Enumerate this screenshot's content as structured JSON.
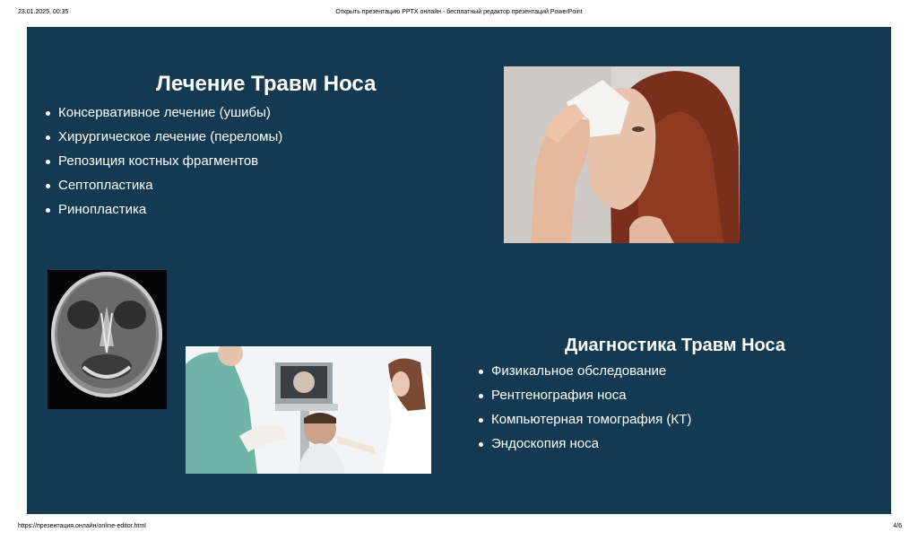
{
  "print": {
    "date": "23.01.2025, 00:35",
    "title": "Открыть презентацию PPTX онлайн - бесплатный редактор презентаций PowerPoint",
    "url": "https://презентация.онлайн/online-editor.html",
    "page": "4/6"
  },
  "slide": {
    "background_color": "#143a52",
    "treatment": {
      "title": "Лечение Травм Носа",
      "items": [
        "Консервативное лечение (ушибы)",
        "Хирургическое лечение (переломы)",
        "Репозиция костных фрагментов",
        "Септопластика",
        "Ринопластика"
      ]
    },
    "diagnostics": {
      "title": "Диагностика Травм Носа",
      "items": [
        "Физикальное обследование",
        "Рентгенография носа",
        "Компьютерная томография (КТ)",
        "Эндоскопия носа"
      ]
    },
    "images": {
      "face": "woman-holding-tissue-to-nose-photo",
      "xray": "skull-xray-photo",
      "exam": "endoscopic-examination-photo"
    }
  }
}
